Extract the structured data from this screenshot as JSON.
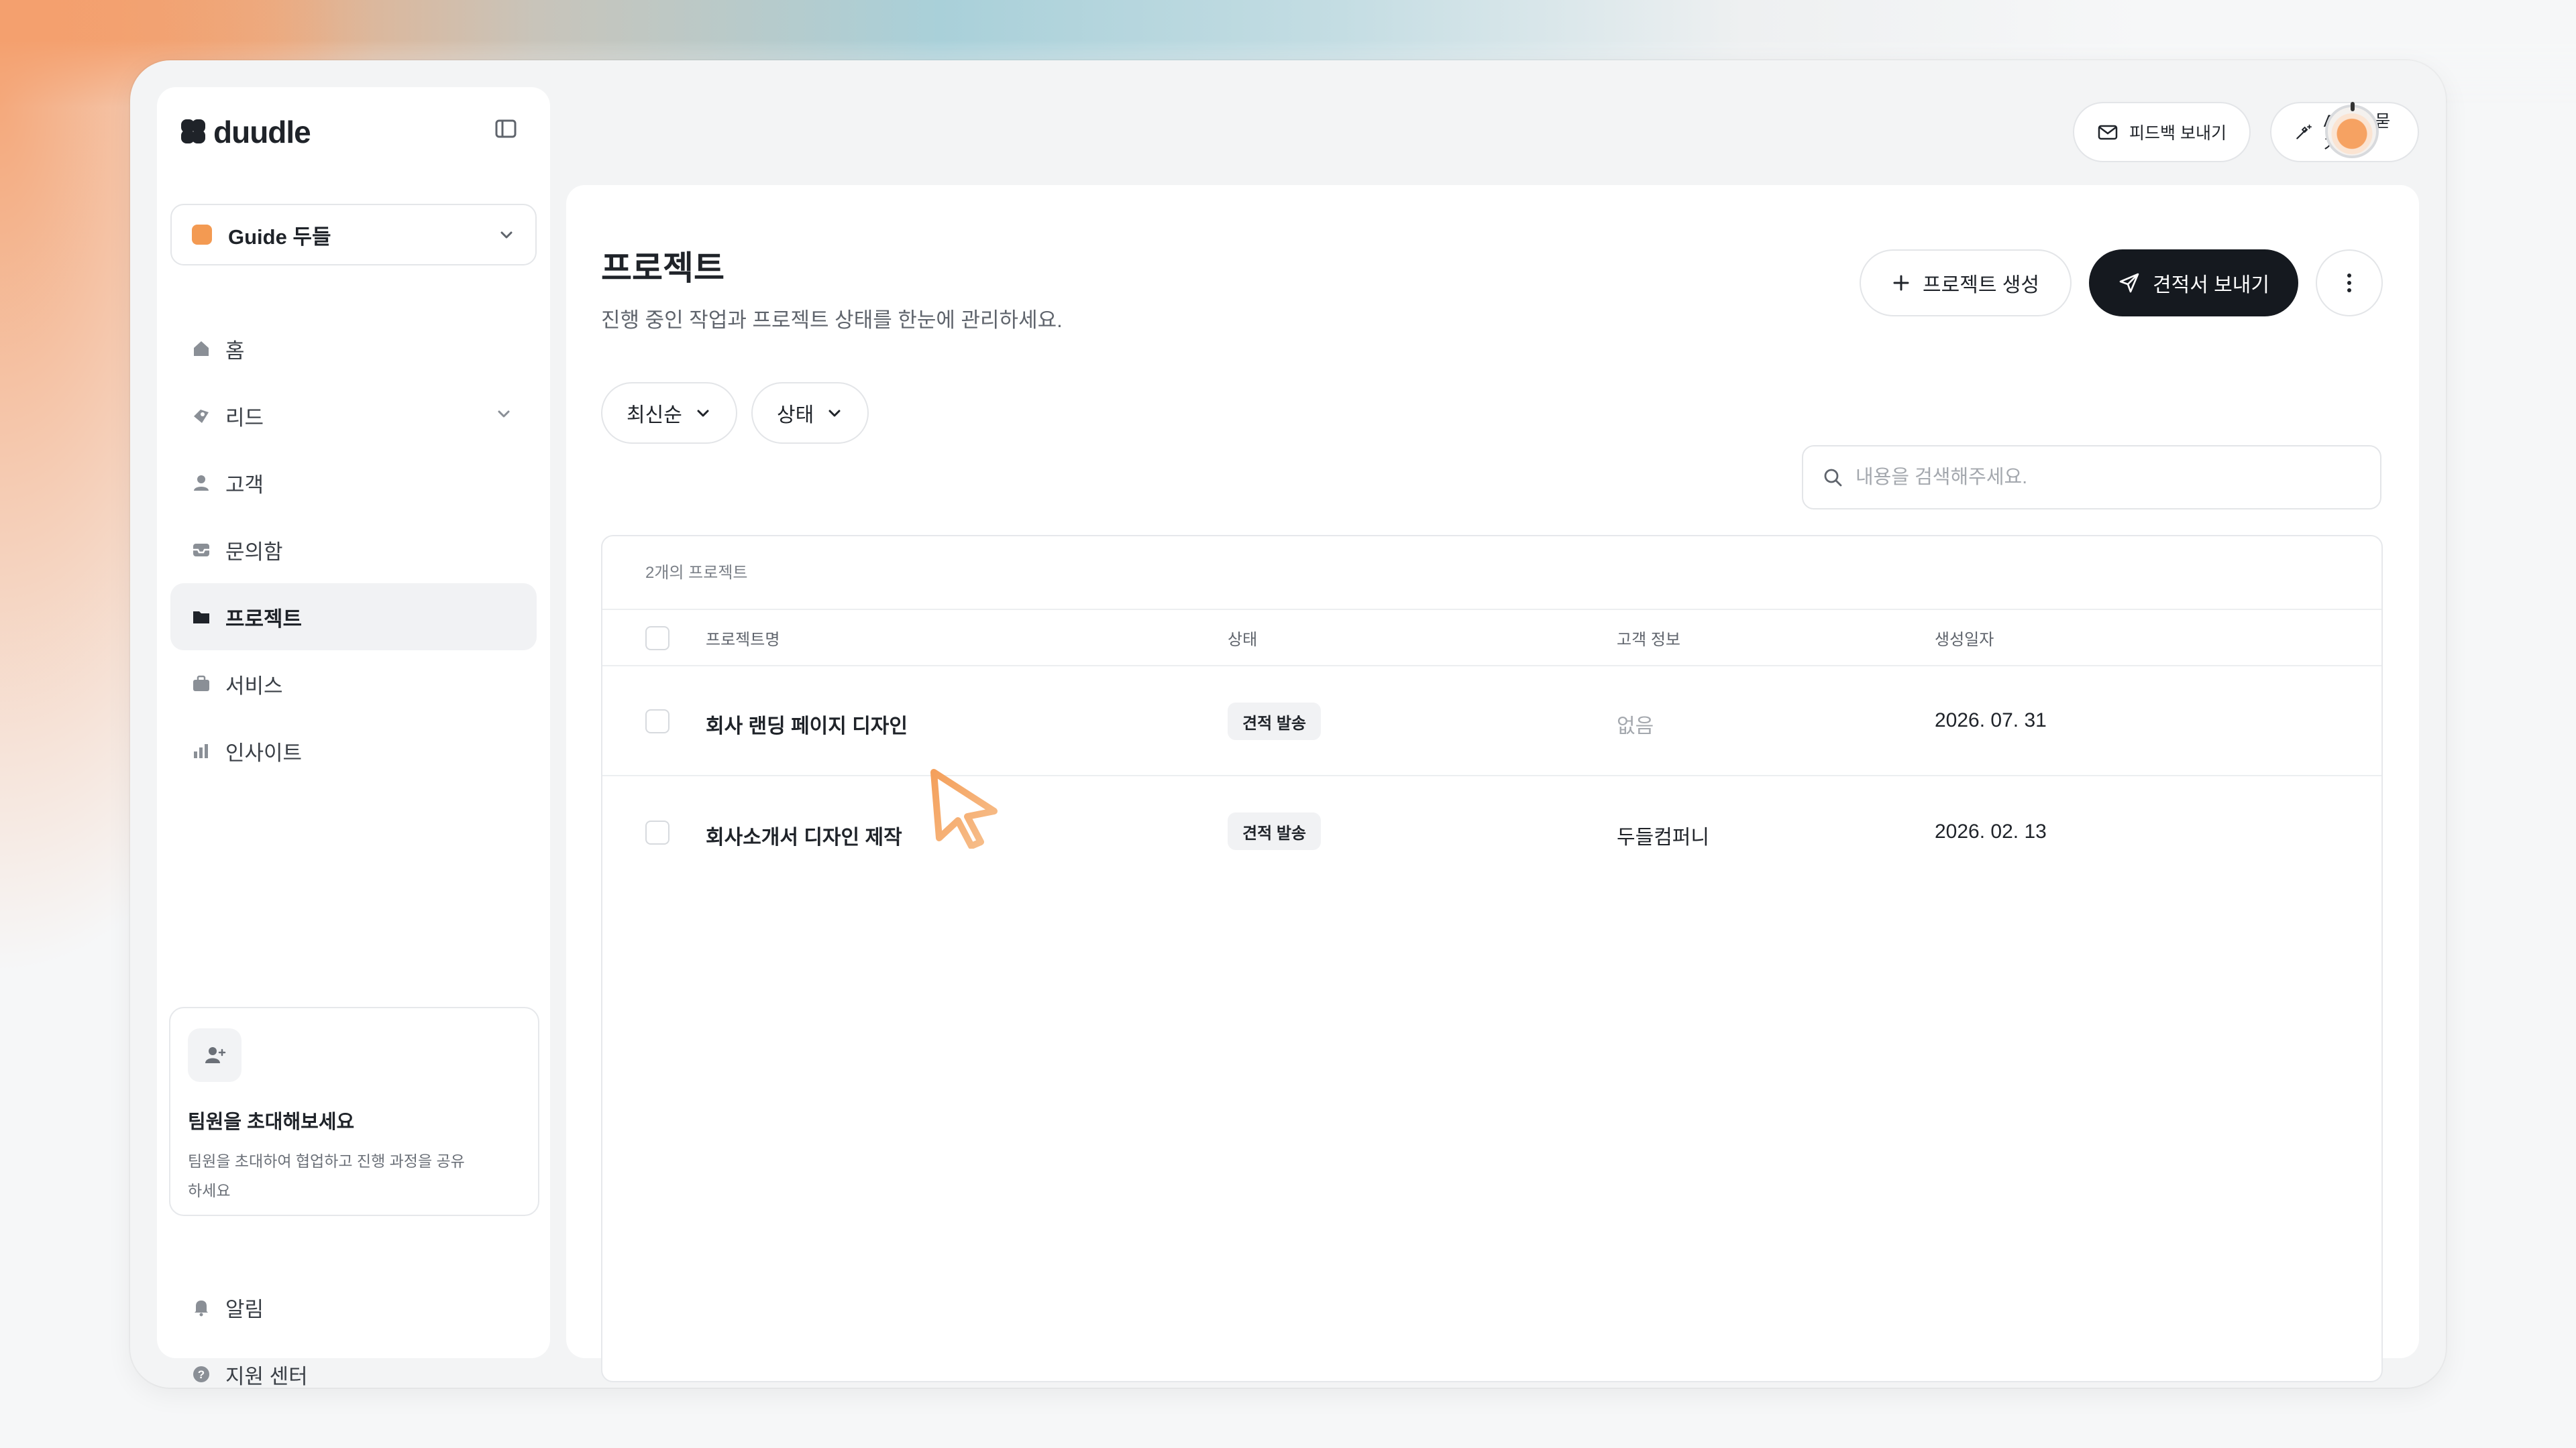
{
  "app": {
    "name": "duudle"
  },
  "workspace": {
    "label": "Guide 두들"
  },
  "sidebar": {
    "items": [
      {
        "label": "홈",
        "icon": "home-icon"
      },
      {
        "label": "리드",
        "icon": "lead-icon"
      },
      {
        "label": "고객",
        "icon": "user-icon"
      },
      {
        "label": "문의함",
        "icon": "inbox-icon"
      },
      {
        "label": "프로젝트",
        "icon": "folder-icon",
        "active": true
      },
      {
        "label": "서비스",
        "icon": "briefcase-icon"
      },
      {
        "label": "인사이트",
        "icon": "chart-icon"
      }
    ],
    "invite": {
      "title": "팀원을 초대해보세요",
      "desc": "팀원을 초대하여 협업하고 진행 과정을 공유하세요"
    },
    "bottom": [
      {
        "label": "알림",
        "icon": "bell-icon"
      },
      {
        "label": "지원 센터",
        "icon": "help-icon"
      }
    ]
  },
  "topbar": {
    "feedback": "피드백 보내기",
    "ask_ai": "AI에게 묻기"
  },
  "page": {
    "title": "프로젝트",
    "subtitle": "진행 중인 작업과 프로젝트 상태를 한눈에 관리하세요.",
    "create_label": "프로젝트 생성",
    "send_label": "견적서 보내기"
  },
  "filters": {
    "sort": "최신순",
    "status": "상태"
  },
  "search": {
    "placeholder": "내용을 검색해주세요."
  },
  "table": {
    "count": "2개의 프로젝트",
    "columns": [
      "프로젝트명",
      "상태",
      "고객 정보",
      "생성일자"
    ],
    "rows": [
      {
        "name": "회사 랜딩 페이지 디자인",
        "status": "견적 발송",
        "client": "없음",
        "date": "2026. 07. 31"
      },
      {
        "name": "회사소개서 디자인 제작",
        "status": "견적 발송",
        "client": "두들컴퍼니",
        "date": "2026. 02. 13"
      }
    ]
  },
  "colors": {
    "accent": "#f39a52",
    "primary_button": "#15191f",
    "active_nav": "#f1f2f4"
  }
}
